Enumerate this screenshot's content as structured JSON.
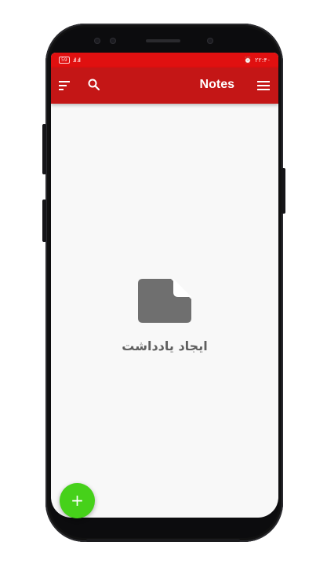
{
  "status_bar": {
    "battery": "59",
    "signal": ".ıll .ıll",
    "time": "۲۲:۴۰",
    "alarm_icon": "alarm-clock-icon"
  },
  "app_bar": {
    "title": "Notes",
    "sort_icon": "sort-icon",
    "search_icon": "search-icon",
    "menu_icon": "hamburger-menu-icon"
  },
  "empty_state": {
    "icon": "note-document-icon",
    "label": "ایجاد یادداشت"
  },
  "fab": {
    "label": "+",
    "icon": "add-icon"
  },
  "colors": {
    "status_bar": "#e01010",
    "app_bar": "#c41616",
    "fab": "#46d11a",
    "empty_icon": "#6f6f6f",
    "background": "#f8f8f8"
  }
}
